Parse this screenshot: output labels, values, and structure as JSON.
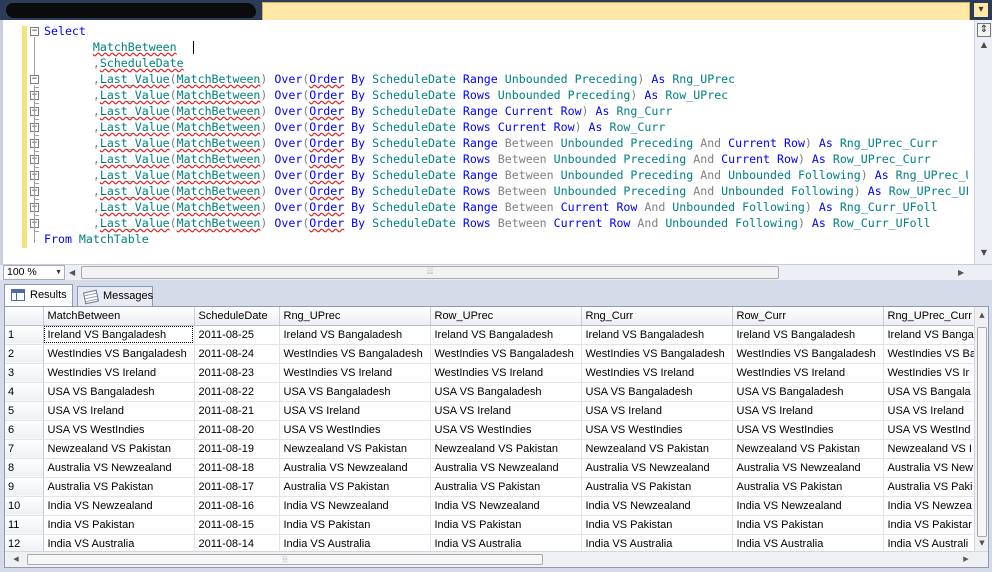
{
  "editor": {
    "lines": [
      [
        {
          "t": "Select",
          "c": "kw"
        }
      ],
      [
        {
          "t": "       "
        },
        {
          "t": "MatchBetween",
          "c": "id sq"
        },
        {
          "t": "  "
        },
        {
          "caret": true
        }
      ],
      [
        {
          "t": "       "
        },
        {
          "t": ",",
          "c": "gr"
        },
        {
          "t": "ScheduleDate",
          "c": "id sq"
        }
      ],
      [
        {
          "t": "       "
        },
        {
          "t": ",",
          "c": "gr"
        },
        {
          "t": "Last_Value",
          "c": "id sq"
        },
        {
          "t": "(",
          "c": "gr"
        },
        {
          "t": "MatchBetween",
          "c": "id sq"
        },
        {
          "t": ")",
          "c": "gr"
        },
        {
          "t": " Over",
          "c": "kw"
        },
        {
          "t": "(",
          "c": "gr"
        },
        {
          "t": "Order",
          "c": "kw sq"
        },
        {
          "t": " By ",
          "c": "kw"
        },
        {
          "t": "ScheduleDate",
          "c": "id"
        },
        {
          "t": " Range ",
          "c": "kw"
        },
        {
          "t": "Unbounded",
          "c": "id"
        },
        {
          "t": " Preceding",
          "c": "id"
        },
        {
          "t": ")",
          "c": "gr"
        },
        {
          "t": " As ",
          "c": "kw"
        },
        {
          "t": "Rng_UPrec",
          "c": "id"
        }
      ],
      [
        {
          "t": "       "
        },
        {
          "t": ",",
          "c": "gr"
        },
        {
          "t": "Last_Value",
          "c": "id sq"
        },
        {
          "t": "(",
          "c": "gr"
        },
        {
          "t": "MatchBetween",
          "c": "id sq"
        },
        {
          "t": ")",
          "c": "gr"
        },
        {
          "t": " Over",
          "c": "kw"
        },
        {
          "t": "(",
          "c": "gr"
        },
        {
          "t": "Order",
          "c": "kw sq"
        },
        {
          "t": " By ",
          "c": "kw"
        },
        {
          "t": "ScheduleDate",
          "c": "id"
        },
        {
          "t": " Rows ",
          "c": "kw"
        },
        {
          "t": "Unbounded",
          "c": "id"
        },
        {
          "t": " Preceding",
          "c": "id"
        },
        {
          "t": ")",
          "c": "gr"
        },
        {
          "t": " As ",
          "c": "kw"
        },
        {
          "t": "Row_UPrec",
          "c": "id"
        }
      ],
      [
        {
          "t": "       "
        },
        {
          "t": ",",
          "c": "gr"
        },
        {
          "t": "Last_Value",
          "c": "id sq"
        },
        {
          "t": "(",
          "c": "gr"
        },
        {
          "t": "MatchBetween",
          "c": "id sq"
        },
        {
          "t": ")",
          "c": "gr"
        },
        {
          "t": " Over",
          "c": "kw"
        },
        {
          "t": "(",
          "c": "gr"
        },
        {
          "t": "Order",
          "c": "kw sq"
        },
        {
          "t": " By ",
          "c": "kw"
        },
        {
          "t": "ScheduleDate",
          "c": "id"
        },
        {
          "t": " Range ",
          "c": "kw"
        },
        {
          "t": "Current Row",
          "c": "kw"
        },
        {
          "t": ")",
          "c": "gr"
        },
        {
          "t": " As ",
          "c": "kw"
        },
        {
          "t": "Rng_Curr",
          "c": "id"
        }
      ],
      [
        {
          "t": "       "
        },
        {
          "t": ",",
          "c": "gr"
        },
        {
          "t": "Last_Value",
          "c": "id sq"
        },
        {
          "t": "(",
          "c": "gr"
        },
        {
          "t": "MatchBetween",
          "c": "id sq"
        },
        {
          "t": ")",
          "c": "gr"
        },
        {
          "t": " Over",
          "c": "kw"
        },
        {
          "t": "(",
          "c": "gr"
        },
        {
          "t": "Order",
          "c": "kw sq"
        },
        {
          "t": " By ",
          "c": "kw"
        },
        {
          "t": "ScheduleDate",
          "c": "id"
        },
        {
          "t": " Rows ",
          "c": "kw"
        },
        {
          "t": "Current Row",
          "c": "kw"
        },
        {
          "t": ")",
          "c": "gr"
        },
        {
          "t": " As ",
          "c": "kw"
        },
        {
          "t": "Row_Curr",
          "c": "id"
        }
      ],
      [
        {
          "t": "       "
        },
        {
          "t": ",",
          "c": "gr"
        },
        {
          "t": "Last_Value",
          "c": "id sq"
        },
        {
          "t": "(",
          "c": "gr"
        },
        {
          "t": "MatchBetween",
          "c": "id sq"
        },
        {
          "t": ")",
          "c": "gr"
        },
        {
          "t": " Over",
          "c": "kw"
        },
        {
          "t": "(",
          "c": "gr"
        },
        {
          "t": "Order",
          "c": "kw sq"
        },
        {
          "t": " By ",
          "c": "kw"
        },
        {
          "t": "ScheduleDate",
          "c": "id"
        },
        {
          "t": " Range ",
          "c": "kw"
        },
        {
          "t": "Between ",
          "c": "gr"
        },
        {
          "t": "Unbounded Preceding",
          "c": "id"
        },
        {
          "t": " And ",
          "c": "gr"
        },
        {
          "t": "Current Row",
          "c": "kw"
        },
        {
          "t": ")",
          "c": "gr"
        },
        {
          "t": " As ",
          "c": "kw"
        },
        {
          "t": "Rng_UPrec_Curr",
          "c": "id"
        }
      ],
      [
        {
          "t": "       "
        },
        {
          "t": ",",
          "c": "gr"
        },
        {
          "t": "Last_Value",
          "c": "id sq"
        },
        {
          "t": "(",
          "c": "gr"
        },
        {
          "t": "MatchBetween",
          "c": "id sq"
        },
        {
          "t": ")",
          "c": "gr"
        },
        {
          "t": " Over",
          "c": "kw"
        },
        {
          "t": "(",
          "c": "gr"
        },
        {
          "t": "Order",
          "c": "kw sq"
        },
        {
          "t": " By ",
          "c": "kw"
        },
        {
          "t": "ScheduleDate",
          "c": "id"
        },
        {
          "t": " Rows ",
          "c": "kw"
        },
        {
          "t": "Between ",
          "c": "gr"
        },
        {
          "t": "Unbounded Preceding",
          "c": "id"
        },
        {
          "t": " And ",
          "c": "gr"
        },
        {
          "t": "Current Row",
          "c": "kw"
        },
        {
          "t": ")",
          "c": "gr"
        },
        {
          "t": " As ",
          "c": "kw"
        },
        {
          "t": "Row_UPrec_Curr",
          "c": "id"
        }
      ],
      [
        {
          "t": "       "
        },
        {
          "t": ",",
          "c": "gr"
        },
        {
          "t": "Last_Value",
          "c": "id sq"
        },
        {
          "t": "(",
          "c": "gr"
        },
        {
          "t": "MatchBetween",
          "c": "id sq"
        },
        {
          "t": ")",
          "c": "gr"
        },
        {
          "t": " Over",
          "c": "kw"
        },
        {
          "t": "(",
          "c": "gr"
        },
        {
          "t": "Order",
          "c": "kw sq"
        },
        {
          "t": " By ",
          "c": "kw"
        },
        {
          "t": "ScheduleDate",
          "c": "id"
        },
        {
          "t": " Range ",
          "c": "kw"
        },
        {
          "t": "Between ",
          "c": "gr"
        },
        {
          "t": "Unbounded Preceding",
          "c": "id"
        },
        {
          "t": " And ",
          "c": "gr"
        },
        {
          "t": "Unbounded Following",
          "c": "id"
        },
        {
          "t": ")",
          "c": "gr"
        },
        {
          "t": " As ",
          "c": "kw"
        },
        {
          "t": "Rng_UPrec_U",
          "c": "id"
        }
      ],
      [
        {
          "t": "       "
        },
        {
          "t": ",",
          "c": "gr"
        },
        {
          "t": "Last_Value",
          "c": "id sq"
        },
        {
          "t": "(",
          "c": "gr"
        },
        {
          "t": "MatchBetween",
          "c": "id sq"
        },
        {
          "t": ")",
          "c": "gr"
        },
        {
          "t": " Over",
          "c": "kw"
        },
        {
          "t": "(",
          "c": "gr"
        },
        {
          "t": "Order",
          "c": "kw sq"
        },
        {
          "t": " By ",
          "c": "kw"
        },
        {
          "t": "ScheduleDate",
          "c": "id"
        },
        {
          "t": " Rows ",
          "c": "kw"
        },
        {
          "t": "Between ",
          "c": "gr"
        },
        {
          "t": "Unbounded Preceding",
          "c": "id"
        },
        {
          "t": " And ",
          "c": "gr"
        },
        {
          "t": "Unbounded Following",
          "c": "id"
        },
        {
          "t": ")",
          "c": "gr"
        },
        {
          "t": " As ",
          "c": "kw"
        },
        {
          "t": "Row_UPrec_UF",
          "c": "id"
        }
      ],
      [
        {
          "t": "       "
        },
        {
          "t": ",",
          "c": "gr"
        },
        {
          "t": "Last_Value",
          "c": "id sq"
        },
        {
          "t": "(",
          "c": "gr"
        },
        {
          "t": "MatchBetween",
          "c": "id sq"
        },
        {
          "t": ")",
          "c": "gr"
        },
        {
          "t": " Over",
          "c": "kw"
        },
        {
          "t": "(",
          "c": "gr"
        },
        {
          "t": "Order",
          "c": "kw sq"
        },
        {
          "t": " By ",
          "c": "kw"
        },
        {
          "t": "ScheduleDate",
          "c": "id"
        },
        {
          "t": " Range ",
          "c": "kw"
        },
        {
          "t": "Between ",
          "c": "gr"
        },
        {
          "t": "Current Row",
          "c": "kw"
        },
        {
          "t": " And ",
          "c": "gr"
        },
        {
          "t": "Unbounded Following",
          "c": "id"
        },
        {
          "t": ")",
          "c": "gr"
        },
        {
          "t": " As ",
          "c": "kw"
        },
        {
          "t": "Rng_Curr_UFoll",
          "c": "id"
        }
      ],
      [
        {
          "t": "       "
        },
        {
          "t": ",",
          "c": "gr"
        },
        {
          "t": "Last_Value",
          "c": "id sq"
        },
        {
          "t": "(",
          "c": "gr"
        },
        {
          "t": "MatchBetween",
          "c": "id sq"
        },
        {
          "t": ")",
          "c": "gr"
        },
        {
          "t": " Over",
          "c": "kw"
        },
        {
          "t": "(",
          "c": "gr"
        },
        {
          "t": "Order",
          "c": "kw sq"
        },
        {
          "t": " By ",
          "c": "kw"
        },
        {
          "t": "ScheduleDate",
          "c": "id"
        },
        {
          "t": " Rows ",
          "c": "kw"
        },
        {
          "t": "Between ",
          "c": "gr"
        },
        {
          "t": "Current Row",
          "c": "kw"
        },
        {
          "t": " And ",
          "c": "gr"
        },
        {
          "t": "Unbounded Following",
          "c": "id"
        },
        {
          "t": ")",
          "c": "gr"
        },
        {
          "t": " As ",
          "c": "kw"
        },
        {
          "t": "Row_Curr_UFoll",
          "c": "id"
        }
      ],
      [
        {
          "t": "From ",
          "c": "kw"
        },
        {
          "t": "MatchTable",
          "c": "id"
        }
      ]
    ]
  },
  "zoom": {
    "value": "100 %"
  },
  "result_tabs": {
    "results": "Results",
    "messages": "Messages"
  },
  "grid": {
    "columns": [
      "",
      "MatchBetween",
      "ScheduleDate",
      "Rng_UPrec",
      "Row_UPrec",
      "Rng_Curr",
      "Row_Curr",
      "Rng_UPrec_Curr"
    ],
    "rows": [
      [
        "1",
        "Ireland VS Bangaladesh",
        "2011-08-25",
        "Ireland VS Bangaladesh",
        "Ireland VS Bangaladesh",
        "Ireland VS Bangaladesh",
        "Ireland VS Bangaladesh",
        "Ireland VS Banga"
      ],
      [
        "2",
        "WestIndies VS Bangaladesh",
        "2011-08-24",
        "WestIndies VS Bangaladesh",
        "WestIndies VS Bangaladesh",
        "WestIndies VS Bangaladesh",
        "WestIndies VS Bangaladesh",
        "WestIndies VS Ba"
      ],
      [
        "3",
        "WestIndies VS Ireland",
        "2011-08-23",
        "WestIndies VS Ireland",
        "WestIndies VS Ireland",
        "WestIndies VS Ireland",
        "WestIndies VS Ireland",
        "WestIndies VS Ir"
      ],
      [
        "4",
        "USA VS Bangaladesh",
        "2011-08-22",
        "USA VS Bangaladesh",
        "USA VS Bangaladesh",
        "USA VS Bangaladesh",
        "USA VS Bangaladesh",
        "USA VS Bangala"
      ],
      [
        "5",
        "USA VS Ireland",
        "2011-08-21",
        "USA VS Ireland",
        "USA VS Ireland",
        "USA VS Ireland",
        "USA VS Ireland",
        "USA VS Ireland"
      ],
      [
        "6",
        "USA VS WestIndies",
        "2011-08-20",
        "USA VS WestIndies",
        "USA VS WestIndies",
        "USA VS WestIndies",
        "USA VS WestIndies",
        "USA VS WestInd"
      ],
      [
        "7",
        "Newzealand VS Pakistan",
        "2011-08-19",
        "Newzealand VS Pakistan",
        "Newzealand VS Pakistan",
        "Newzealand VS Pakistan",
        "Newzealand VS Pakistan",
        "Newzealand VS I"
      ],
      [
        "8",
        "Australia VS Newzealand",
        "2011-08-18",
        "Australia VS Newzealand",
        "Australia VS Newzealand",
        "Australia VS Newzealand",
        "Australia VS Newzealand",
        "Australia VS New"
      ],
      [
        "9",
        "Australia VS Pakistan",
        "2011-08-17",
        "Australia VS Pakistan",
        "Australia VS Pakistan",
        "Australia VS Pakistan",
        "Australia VS Pakistan",
        "Australia VS Paki"
      ],
      [
        "10",
        "India VS Newzealand",
        "2011-08-16",
        "India VS Newzealand",
        "India VS Newzealand",
        "India VS Newzealand",
        "India VS Newzealand",
        "India VS Newzea"
      ],
      [
        "11",
        "India VS Pakistan",
        "2011-08-15",
        "India VS Pakistan",
        "India VS Pakistan",
        "India VS Pakistan",
        "India VS Pakistan",
        "India VS Pakistar"
      ],
      [
        "12",
        "India VS Australia",
        "2011-08-14",
        "India VS Australia",
        "India VS Australia",
        "India VS Australia",
        "India VS Australia",
        "India VS Australi"
      ]
    ]
  },
  "icons": {
    "editor_splitter": "split-icon",
    "results_tab": "grid-icon",
    "messages_tab": "messages-icon"
  }
}
